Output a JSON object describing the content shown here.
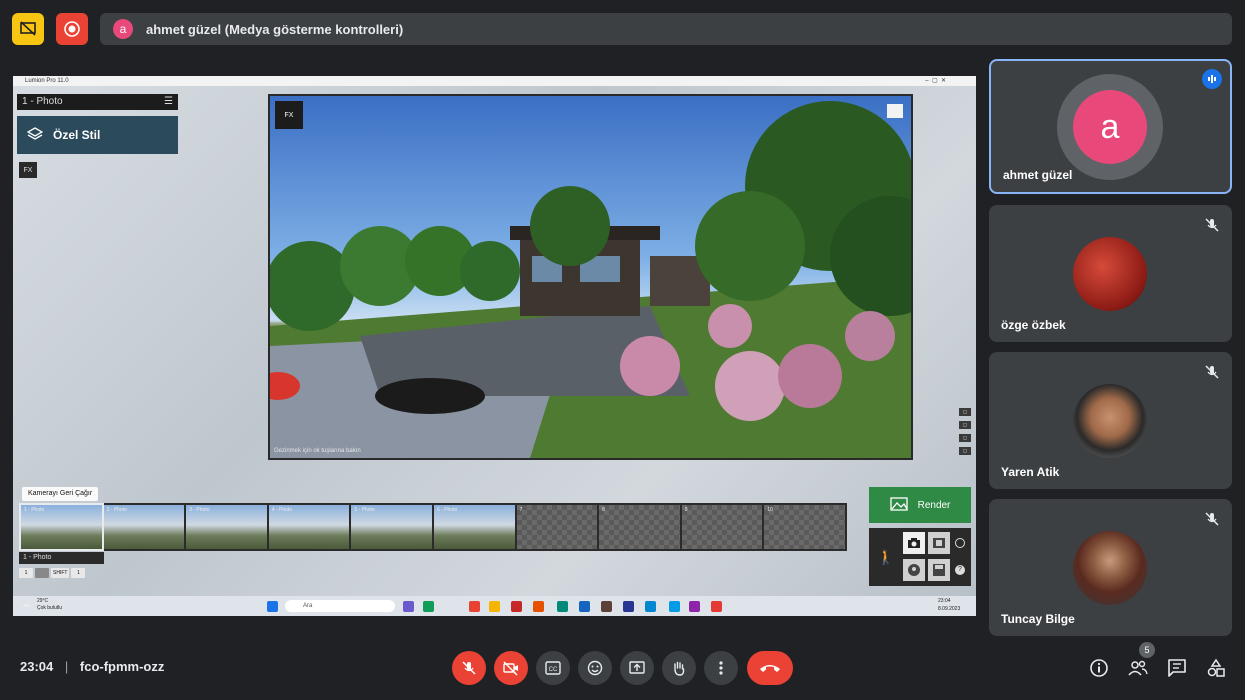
{
  "presenter_banner": {
    "avatar_letter": "a",
    "text": "ahmet güzel (Medya gösterme kontrolleri)"
  },
  "shared_screen": {
    "window_title": "Lumion Pro 11.0",
    "photo_header": "1 - Photo",
    "style_button": "Özel Stil",
    "fx_label": "FX",
    "viewport_caption": "Gezinmek için ok tuşlarına bakın",
    "recall_tooltip": "Kamerayı Geri Çağır",
    "thumbnails": [
      {
        "label": "1 - Photo",
        "filled": true,
        "active": true
      },
      {
        "label": "2 - Photo",
        "filled": true
      },
      {
        "label": "3 - Photo",
        "filled": true
      },
      {
        "label": "4 - Photo",
        "filled": true
      },
      {
        "label": "5 - Photo",
        "filled": true
      },
      {
        "label": "6 - Photo",
        "filled": true
      },
      {
        "label": "7",
        "filled": false
      },
      {
        "label": "8",
        "filled": false
      },
      {
        "label": "9",
        "filled": false
      },
      {
        "label": "10",
        "filled": false
      }
    ],
    "selected_label": "1 - Photo",
    "keys": [
      "1",
      "",
      "SHIFT",
      "1"
    ],
    "render_button": "Render",
    "taskbar": {
      "weather_temp": "29°C",
      "weather_text": "Çok bulutlu",
      "search_placeholder": "Ara",
      "time": "23:04",
      "date": "8.09.2023"
    }
  },
  "participants": [
    {
      "name": "ahmet güzel",
      "letter": "a",
      "speaking": true
    },
    {
      "name": "özge özbek",
      "letter": ""
    },
    {
      "name": "Yaren Atik",
      "letter": ""
    },
    {
      "name": "Tuncay Bilge",
      "letter": ""
    }
  ],
  "bottom_bar": {
    "time": "23:04",
    "separator": "|",
    "meeting_code": "fco-fpmm-ozz",
    "people_count": "5"
  },
  "colors": {
    "accent_blue": "#8ab4f8",
    "danger_red": "#ea4335",
    "avatar_pink": "#e8497a",
    "render_green": "#2f8a45"
  }
}
